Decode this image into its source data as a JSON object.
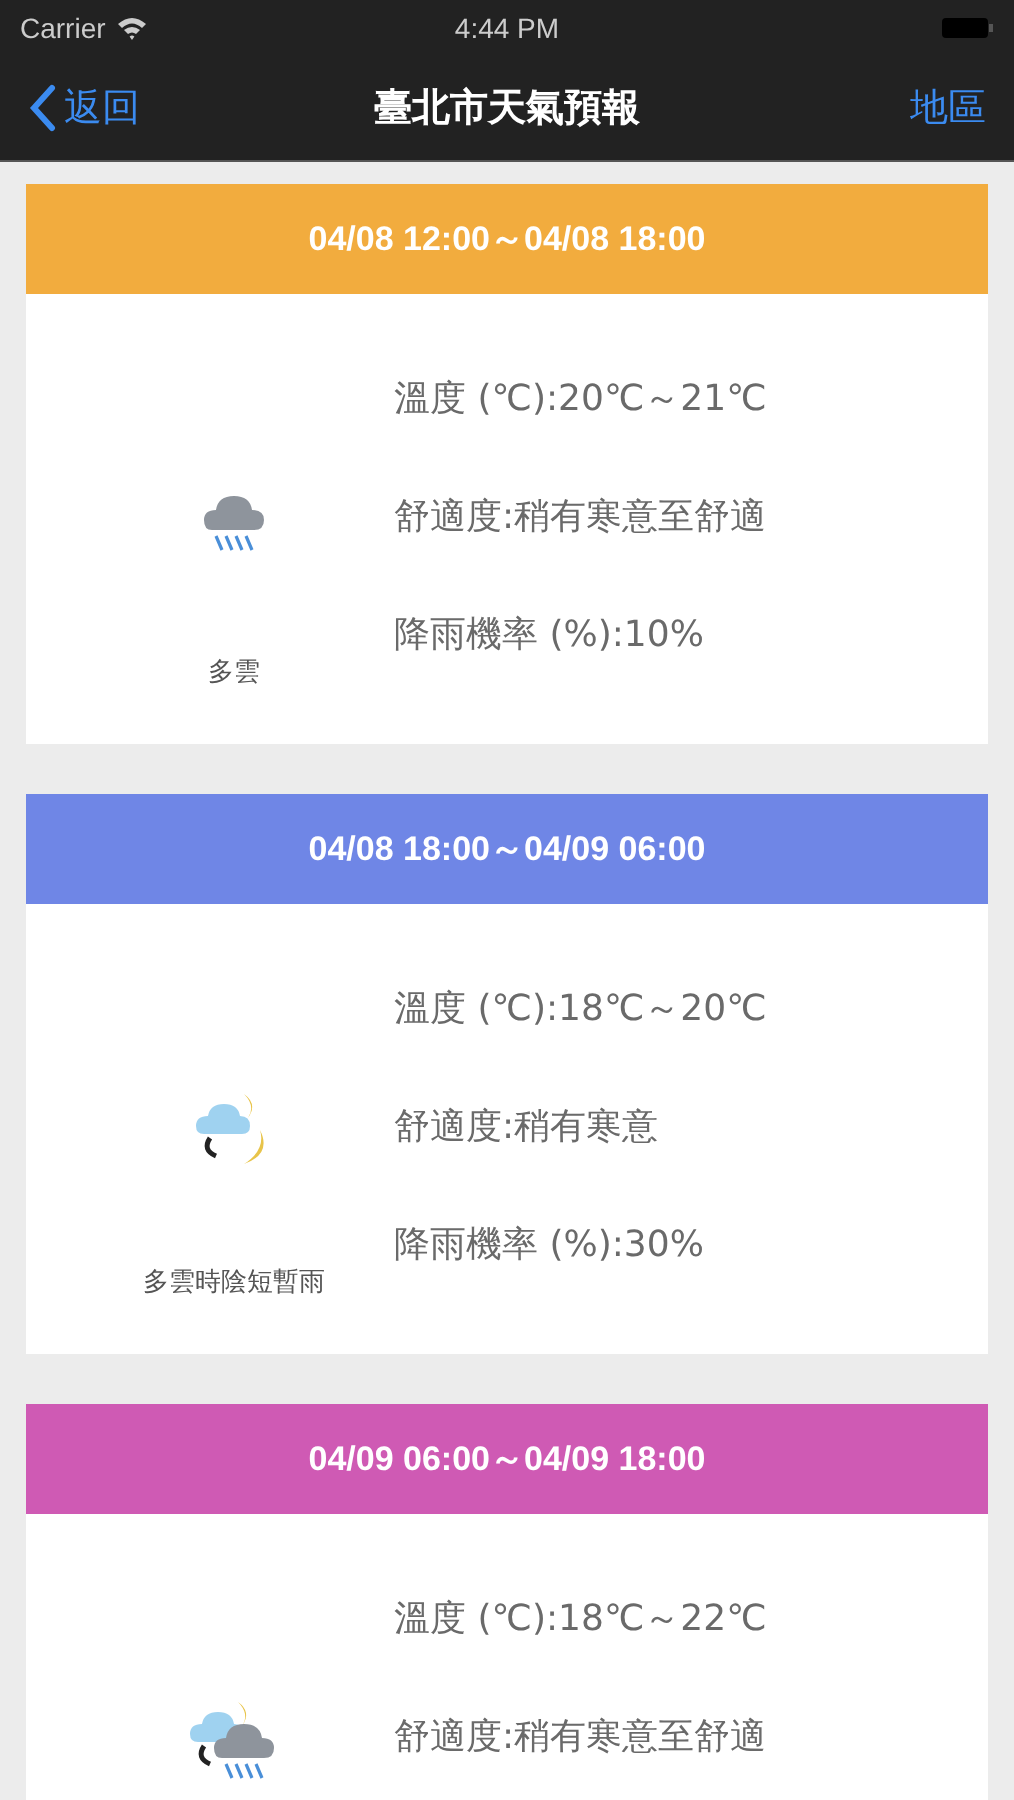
{
  "status_bar": {
    "carrier": "Carrier",
    "time": "4:44 PM"
  },
  "nav": {
    "back": "返回",
    "title": "臺北市天氣預報",
    "action": "地區"
  },
  "forecasts": [
    {
      "period": "04/08 12:00～04/08 18:00",
      "color": "#f2ac3e",
      "kind": "rain",
      "description": "多雲",
      "details": [
        "溫度 (℃):20℃～21℃",
        "舒適度:稍有寒意至舒適",
        "降雨機率 (%):10%"
      ]
    },
    {
      "period": "04/08 18:00～04/09 06:00",
      "color": "#6f86e6",
      "kind": "moon-cloud",
      "description": "多雲時陰短暫雨",
      "details": [
        "溫度 (℃):18℃～20℃",
        "舒適度:稍有寒意",
        "降雨機率 (%):30%"
      ]
    },
    {
      "period": "04/09 06:00～04/09 18:00",
      "color": "#cf5ab4",
      "kind": "moon-cloud-rain",
      "details": [
        "溫度 (℃):18℃～22℃",
        "舒適度:稍有寒意至舒適"
      ]
    }
  ]
}
